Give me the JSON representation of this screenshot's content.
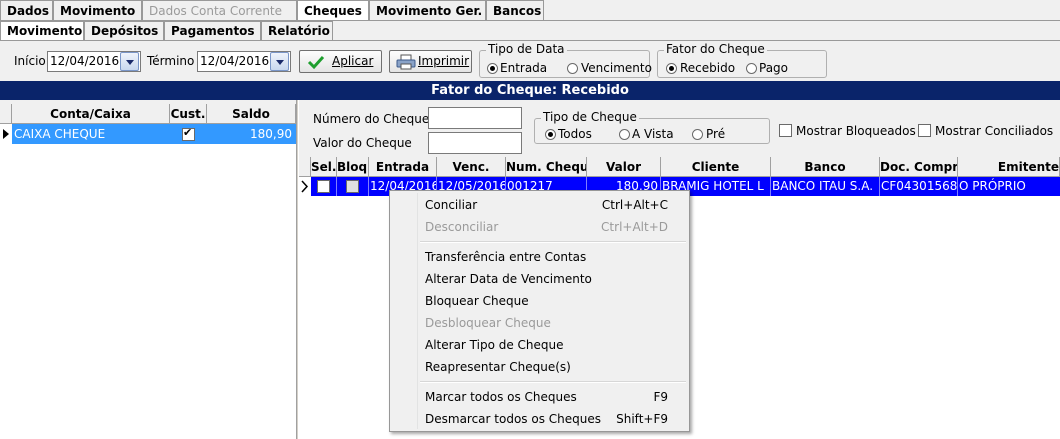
{
  "main_tabs": [
    {
      "label": "Dados",
      "state": "normal"
    },
    {
      "label": "Movimento",
      "state": "normal"
    },
    {
      "label": "Dados Conta Corrente",
      "state": "disabled"
    },
    {
      "label": "Cheques",
      "state": "active"
    },
    {
      "label": "Movimento Ger.",
      "state": "normal"
    },
    {
      "label": "Bancos",
      "state": "normal"
    }
  ],
  "sub_tabs": [
    {
      "label": "Movimento",
      "state": "active"
    },
    {
      "label": "Depósitos",
      "state": "normal"
    },
    {
      "label": "Pagamentos",
      "state": "normal"
    },
    {
      "label": "Relatório",
      "state": "normal"
    }
  ],
  "filters": {
    "inicio_label": "Início",
    "inicio_value": "12/04/2016",
    "termino_label": "Término",
    "termino_value": "12/04/2016",
    "aplicar_label": "Aplicar",
    "imprimir_label": "Imprimir",
    "tipo_data": {
      "title": "Tipo de Data",
      "options": [
        "Entrada",
        "Vencimento"
      ],
      "selected": "Entrada"
    },
    "fator_cheque": {
      "title": "Fator do Cheque",
      "options": [
        "Recebido",
        "Pago"
      ],
      "selected": "Recebido"
    }
  },
  "title_bar": "Fator do Cheque: Recebido",
  "left_grid": {
    "columns": [
      "Conta/Caixa",
      "Cust.",
      "Saldo"
    ],
    "rows": [
      {
        "conta": "CAIXA CHEQUE",
        "cust": true,
        "saldo": "180,90"
      }
    ]
  },
  "search": {
    "numero_label": "Número do Cheque",
    "valor_label": "Valor do Cheque",
    "tipo_cheque": {
      "title": "Tipo de Cheque",
      "options": [
        "Todos",
        "A Vista",
        "Pré"
      ],
      "selected": "Todos"
    },
    "mostrar_bloqueados": "Mostrar Bloqueados",
    "mostrar_conciliados": "Mostrar Conciliados"
  },
  "right_grid": {
    "columns": [
      "Sel.",
      "Bloq.",
      "Entrada",
      "Venc.",
      "Num. Cheque",
      "Valor",
      "Cliente",
      "Banco",
      "Doc. Compra",
      "Emitente"
    ],
    "rows": [
      {
        "sel": true,
        "bloq": false,
        "entrada": "12/04/2016",
        "venc": "12/05/2016",
        "num": "001217",
        "valor": "180,90",
        "cliente": "BRAMIG HOTEL L",
        "banco": "BANCO ITAU S.A.",
        "doc": "CF04301568",
        "emitente": "O PRÓPRIO"
      }
    ]
  },
  "context_menu": {
    "items": [
      {
        "label": "Conciliar",
        "shortcut": "Ctrl+Alt+C",
        "enabled": true
      },
      {
        "label": "Desconciliar",
        "shortcut": "Ctrl+Alt+D",
        "enabled": false
      },
      {
        "label": "Transferência entre Contas",
        "shortcut": "",
        "enabled": true
      },
      {
        "label": "Alterar Data de Vencimento",
        "shortcut": "",
        "enabled": true
      },
      {
        "label": "Bloquear Cheque",
        "shortcut": "",
        "enabled": true
      },
      {
        "label": "Desbloquear Cheque",
        "shortcut": "",
        "enabled": false
      },
      {
        "label": "Alterar Tipo de Cheque",
        "shortcut": "",
        "enabled": true
      },
      {
        "label": "Reapresentar Cheque(s)",
        "shortcut": "",
        "enabled": true
      },
      {
        "label": "Marcar todos os Cheques",
        "shortcut": "F9",
        "enabled": true
      },
      {
        "label": "Desmarcar todos os Cheques",
        "shortcut": "Shift+F9",
        "enabled": true
      }
    ]
  },
  "colors": {
    "selection": "#0000ff",
    "title_bar": "#0a246a",
    "left_selection": "#3399ff"
  }
}
